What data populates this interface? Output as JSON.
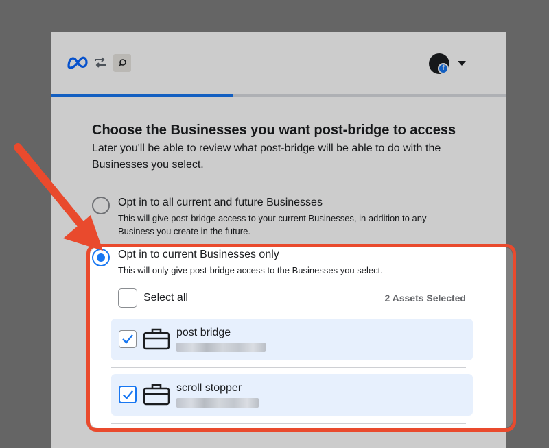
{
  "colors": {
    "accent": "#1877f2",
    "highlight": "#e94a2d",
    "row_bg": "#e7f0fd"
  },
  "header": {
    "logo_icon": "meta-logo",
    "switch_icon": "swap-arrows-icon",
    "app_icon": "post-bridge-app-icon",
    "account_icon": "profile-avatar",
    "menu_icon": "caret-down-icon"
  },
  "progress": {
    "fraction": 0.4
  },
  "page": {
    "title": "Choose the Businesses you want post-bridge to access",
    "subtitle": "Later you'll be able to review what post-bridge will be able to do with the Businesses you select."
  },
  "options": [
    {
      "label": "Opt in to all current and future Businesses",
      "description": "This will give post-bridge access to your current Businesses, in addition to any Business you create in the future.",
      "selected": false
    },
    {
      "label": "Opt in to current Businesses only",
      "description": "This will only give post-bridge access to the Businesses you select.",
      "selected": true
    }
  ],
  "selection": {
    "select_all_label": "Select all",
    "assets_selected": "2 Assets Selected"
  },
  "businesses": [
    {
      "name": "post bridge",
      "icon": "briefcase-icon",
      "checked": true
    },
    {
      "name": "scroll stopper",
      "icon": "briefcase-icon",
      "checked": true
    }
  ]
}
